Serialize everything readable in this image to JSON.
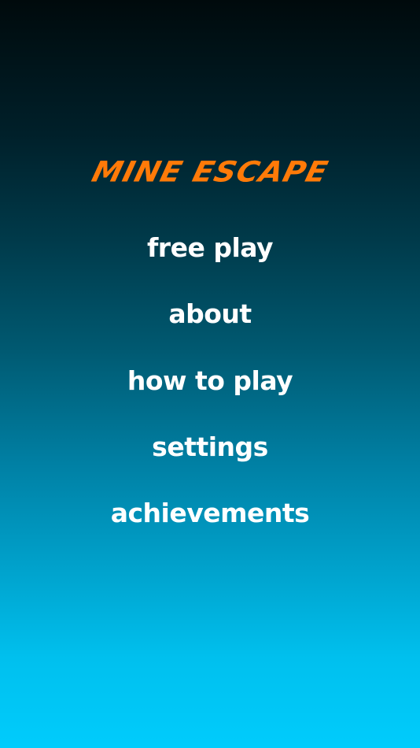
{
  "game": {
    "title": "MINE ESCAPE",
    "title_color": "#ff7a08",
    "background_top_color": "#000a0c",
    "background_bottom_color": "#00ccfc"
  },
  "menu": {
    "items": [
      {
        "label": "free play"
      },
      {
        "label": "about"
      },
      {
        "label": "how to play"
      },
      {
        "label": "settings"
      },
      {
        "label": "achievements"
      }
    ]
  }
}
